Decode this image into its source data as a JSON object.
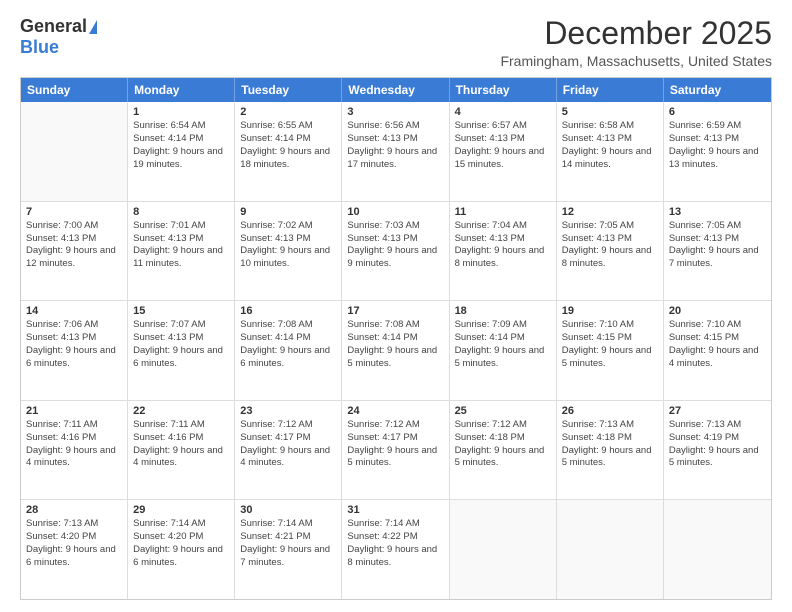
{
  "header": {
    "logo_general": "General",
    "logo_blue": "Blue",
    "title": "December 2025",
    "location": "Framingham, Massachusetts, United States"
  },
  "days_of_week": [
    "Sunday",
    "Monday",
    "Tuesday",
    "Wednesday",
    "Thursday",
    "Friday",
    "Saturday"
  ],
  "rows": [
    [
      {
        "day": "",
        "empty": true
      },
      {
        "day": "1",
        "sunrise": "Sunrise: 6:54 AM",
        "sunset": "Sunset: 4:14 PM",
        "daylight": "Daylight: 9 hours and 19 minutes."
      },
      {
        "day": "2",
        "sunrise": "Sunrise: 6:55 AM",
        "sunset": "Sunset: 4:14 PM",
        "daylight": "Daylight: 9 hours and 18 minutes."
      },
      {
        "day": "3",
        "sunrise": "Sunrise: 6:56 AM",
        "sunset": "Sunset: 4:13 PM",
        "daylight": "Daylight: 9 hours and 17 minutes."
      },
      {
        "day": "4",
        "sunrise": "Sunrise: 6:57 AM",
        "sunset": "Sunset: 4:13 PM",
        "daylight": "Daylight: 9 hours and 15 minutes."
      },
      {
        "day": "5",
        "sunrise": "Sunrise: 6:58 AM",
        "sunset": "Sunset: 4:13 PM",
        "daylight": "Daylight: 9 hours and 14 minutes."
      },
      {
        "day": "6",
        "sunrise": "Sunrise: 6:59 AM",
        "sunset": "Sunset: 4:13 PM",
        "daylight": "Daylight: 9 hours and 13 minutes."
      }
    ],
    [
      {
        "day": "7",
        "sunrise": "Sunrise: 7:00 AM",
        "sunset": "Sunset: 4:13 PM",
        "daylight": "Daylight: 9 hours and 12 minutes."
      },
      {
        "day": "8",
        "sunrise": "Sunrise: 7:01 AM",
        "sunset": "Sunset: 4:13 PM",
        "daylight": "Daylight: 9 hours and 11 minutes."
      },
      {
        "day": "9",
        "sunrise": "Sunrise: 7:02 AM",
        "sunset": "Sunset: 4:13 PM",
        "daylight": "Daylight: 9 hours and 10 minutes."
      },
      {
        "day": "10",
        "sunrise": "Sunrise: 7:03 AM",
        "sunset": "Sunset: 4:13 PM",
        "daylight": "Daylight: 9 hours and 9 minutes."
      },
      {
        "day": "11",
        "sunrise": "Sunrise: 7:04 AM",
        "sunset": "Sunset: 4:13 PM",
        "daylight": "Daylight: 9 hours and 8 minutes."
      },
      {
        "day": "12",
        "sunrise": "Sunrise: 7:05 AM",
        "sunset": "Sunset: 4:13 PM",
        "daylight": "Daylight: 9 hours and 8 minutes."
      },
      {
        "day": "13",
        "sunrise": "Sunrise: 7:05 AM",
        "sunset": "Sunset: 4:13 PM",
        "daylight": "Daylight: 9 hours and 7 minutes."
      }
    ],
    [
      {
        "day": "14",
        "sunrise": "Sunrise: 7:06 AM",
        "sunset": "Sunset: 4:13 PM",
        "daylight": "Daylight: 9 hours and 6 minutes."
      },
      {
        "day": "15",
        "sunrise": "Sunrise: 7:07 AM",
        "sunset": "Sunset: 4:13 PM",
        "daylight": "Daylight: 9 hours and 6 minutes."
      },
      {
        "day": "16",
        "sunrise": "Sunrise: 7:08 AM",
        "sunset": "Sunset: 4:14 PM",
        "daylight": "Daylight: 9 hours and 6 minutes."
      },
      {
        "day": "17",
        "sunrise": "Sunrise: 7:08 AM",
        "sunset": "Sunset: 4:14 PM",
        "daylight": "Daylight: 9 hours and 5 minutes."
      },
      {
        "day": "18",
        "sunrise": "Sunrise: 7:09 AM",
        "sunset": "Sunset: 4:14 PM",
        "daylight": "Daylight: 9 hours and 5 minutes."
      },
      {
        "day": "19",
        "sunrise": "Sunrise: 7:10 AM",
        "sunset": "Sunset: 4:15 PM",
        "daylight": "Daylight: 9 hours and 5 minutes."
      },
      {
        "day": "20",
        "sunrise": "Sunrise: 7:10 AM",
        "sunset": "Sunset: 4:15 PM",
        "daylight": "Daylight: 9 hours and 4 minutes."
      }
    ],
    [
      {
        "day": "21",
        "sunrise": "Sunrise: 7:11 AM",
        "sunset": "Sunset: 4:16 PM",
        "daylight": "Daylight: 9 hours and 4 minutes."
      },
      {
        "day": "22",
        "sunrise": "Sunrise: 7:11 AM",
        "sunset": "Sunset: 4:16 PM",
        "daylight": "Daylight: 9 hours and 4 minutes."
      },
      {
        "day": "23",
        "sunrise": "Sunrise: 7:12 AM",
        "sunset": "Sunset: 4:17 PM",
        "daylight": "Daylight: 9 hours and 4 minutes."
      },
      {
        "day": "24",
        "sunrise": "Sunrise: 7:12 AM",
        "sunset": "Sunset: 4:17 PM",
        "daylight": "Daylight: 9 hours and 5 minutes."
      },
      {
        "day": "25",
        "sunrise": "Sunrise: 7:12 AM",
        "sunset": "Sunset: 4:18 PM",
        "daylight": "Daylight: 9 hours and 5 minutes."
      },
      {
        "day": "26",
        "sunrise": "Sunrise: 7:13 AM",
        "sunset": "Sunset: 4:18 PM",
        "daylight": "Daylight: 9 hours and 5 minutes."
      },
      {
        "day": "27",
        "sunrise": "Sunrise: 7:13 AM",
        "sunset": "Sunset: 4:19 PM",
        "daylight": "Daylight: 9 hours and 5 minutes."
      }
    ],
    [
      {
        "day": "28",
        "sunrise": "Sunrise: 7:13 AM",
        "sunset": "Sunset: 4:20 PM",
        "daylight": "Daylight: 9 hours and 6 minutes."
      },
      {
        "day": "29",
        "sunrise": "Sunrise: 7:14 AM",
        "sunset": "Sunset: 4:20 PM",
        "daylight": "Daylight: 9 hours and 6 minutes."
      },
      {
        "day": "30",
        "sunrise": "Sunrise: 7:14 AM",
        "sunset": "Sunset: 4:21 PM",
        "daylight": "Daylight: 9 hours and 7 minutes."
      },
      {
        "day": "31",
        "sunrise": "Sunrise: 7:14 AM",
        "sunset": "Sunset: 4:22 PM",
        "daylight": "Daylight: 9 hours and 8 minutes."
      },
      {
        "day": "",
        "empty": true
      },
      {
        "day": "",
        "empty": true
      },
      {
        "day": "",
        "empty": true
      }
    ]
  ]
}
